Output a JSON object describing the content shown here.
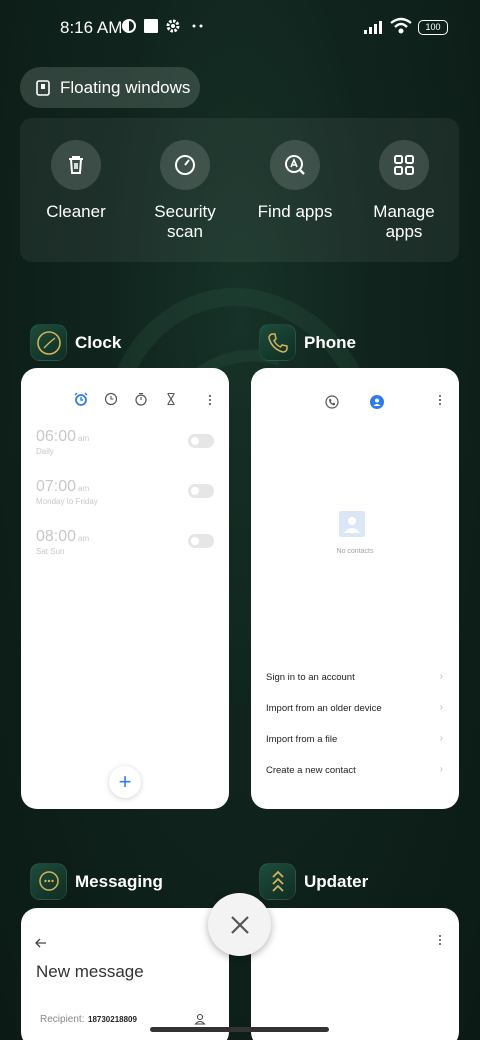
{
  "status_bar": {
    "time": "8:16 AM",
    "battery": "100"
  },
  "floating_windows": {
    "label": "Floating windows"
  },
  "quick_tools": [
    {
      "label": "Cleaner",
      "icon": "trash-icon"
    },
    {
      "label": "Security\nscan",
      "icon": "speedometer-icon"
    },
    {
      "label": "Find apps",
      "icon": "search-apps-icon"
    },
    {
      "label": "Manage\napps",
      "icon": "grid-icon"
    }
  ],
  "apps": {
    "clock": {
      "name": "Clock",
      "alarms": [
        {
          "time": "06:00",
          "ampm": "am",
          "days": "Daily"
        },
        {
          "time": "07:00",
          "ampm": "am",
          "days": "Monday to Friday"
        },
        {
          "time": "08:00",
          "ampm": "am",
          "days": "Sat Sun"
        }
      ],
      "fab": "+"
    },
    "phone": {
      "name": "Phone",
      "empty_text": "No contacts",
      "options": [
        "Sign in to an account",
        "Import from an older device",
        "Import from a file",
        "Create a new contact"
      ]
    },
    "messaging": {
      "name": "Messaging",
      "title": "New message",
      "recipient_label": "Recipient:",
      "recipient_value": "18730218809"
    },
    "updater": {
      "name": "Updater"
    }
  },
  "colors": {
    "accent_blue": "#2f7bea",
    "background": "#0e1f19"
  }
}
